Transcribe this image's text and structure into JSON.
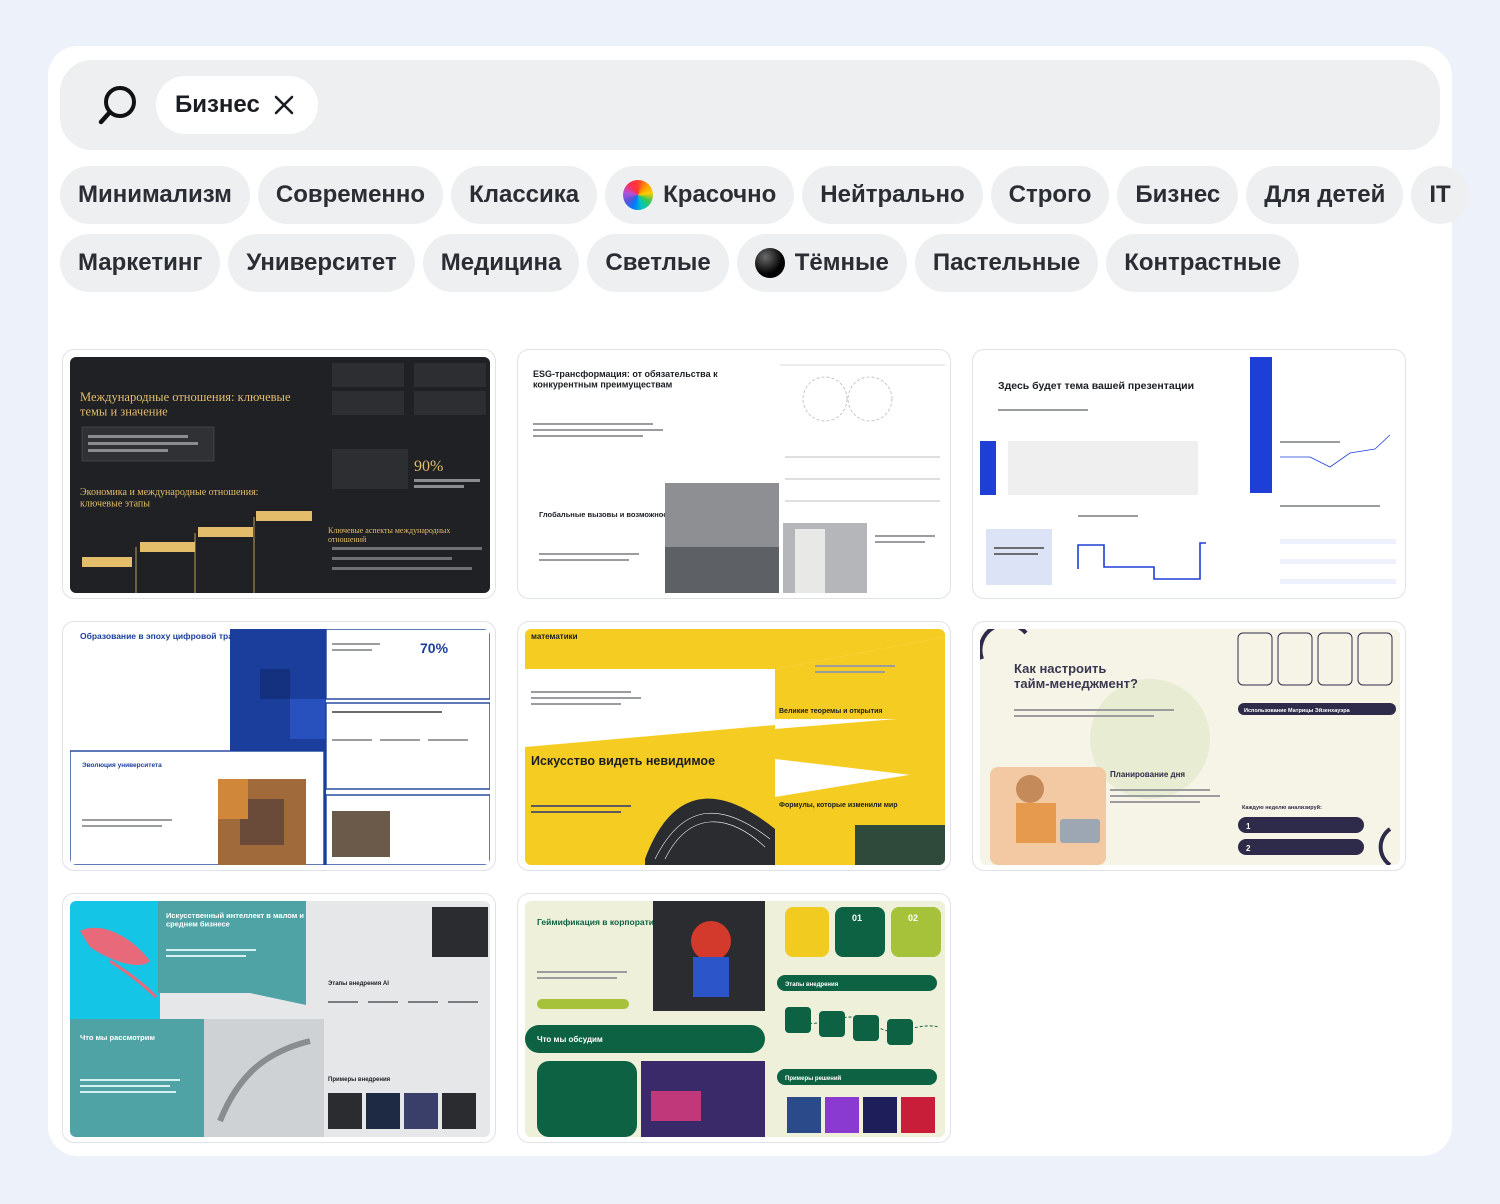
{
  "search": {
    "icon": "search-icon",
    "query_chip": {
      "label": "Бизнес",
      "remove_icon": "close-icon"
    }
  },
  "filters": {
    "row1": [
      "Минимализм",
      "Современно",
      "Классика",
      "Красочно",
      "Нейтрально",
      "Строго",
      "Бизнес",
      "Для детей",
      "IT"
    ],
    "row2": [
      "Маркетинг",
      "Университет",
      "Медицина",
      "Светлые",
      "Тёмные",
      "Пастельные",
      "Контрастные"
    ]
  },
  "templates": [
    {
      "title": "Международные отношения: ключевые темы и значение",
      "subtitle": "Экономика и международные отношения: ключевые этапы",
      "stat": "90%",
      "caption": "Ключевые аспекты международных отношений",
      "colors": {
        "bg": "#1f2124",
        "accent": "#e3bd6a"
      }
    },
    {
      "title": "ESG-трансформация: от обязательства к конкурентным преимуществам",
      "subtitle": "Глобальные вызовы и возможности устойчивого развития",
      "colors": {
        "bg": "#ffffff",
        "accent": "#1a1d22"
      }
    },
    {
      "title": "Здесь будет тема вашей презентации",
      "colors": {
        "bg": "#ffffff",
        "accent": "#1e3fd6"
      }
    },
    {
      "title": "Образование в эпоху цифровой трансформации",
      "stat": "70%",
      "subtitle": "Эволюция университета",
      "colors": {
        "bg": "#ffffff",
        "accent": "#1b3e9c"
      }
    },
    {
      "title": "математики",
      "headline": "Искусство видеть невидимое",
      "caption_1": "Великие теоремы и открытия",
      "caption_2": "Формулы, которые изменили мир",
      "colors": {
        "bg": "#f5cd22",
        "accent": "#1a1d22"
      }
    },
    {
      "title": "Как настроить тайм-менеджмент?",
      "subtitle": "Планирование дня",
      "caption": "Использование Матрицы Эйзенхауэра",
      "caption_2": "Каждую неделю анализируй:",
      "step_1": "1",
      "step_2": "2",
      "colors": {
        "bg": "#f6f4e6",
        "accent": "#2e2a4a"
      }
    },
    {
      "title": "Искусственный интеллект в малом и среднем бизнесе",
      "subtitle": "Что мы рассмотрим",
      "caption": "Этапы внедрения AI",
      "caption_2": "Примеры внедрения",
      "colors": {
        "bg": "#e6e7e9",
        "accent": "#4fa3a5"
      }
    },
    {
      "title": "Геймификация в корпоративном обучении",
      "subtitle": "Что мы обсудим",
      "caption": "Этапы внедрения",
      "caption_2": "Примеры решений",
      "num_1": "01",
      "num_2": "02",
      "colors": {
        "bg": "#eef0da",
        "accent": "#0e6244"
      }
    }
  ]
}
